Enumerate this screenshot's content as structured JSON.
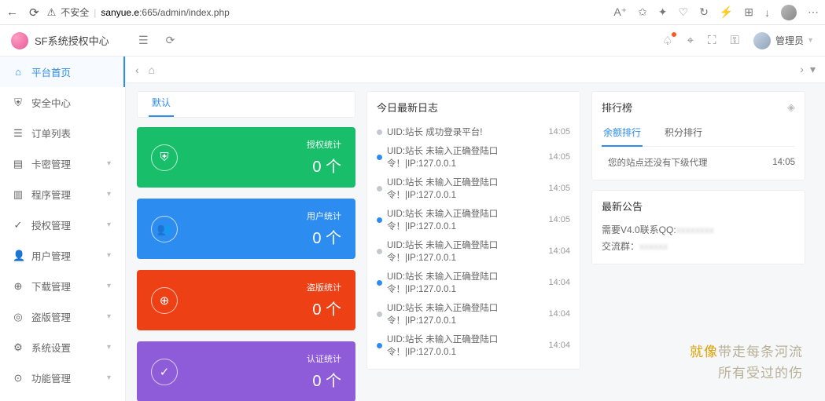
{
  "browser": {
    "insecure_label": "不安全",
    "url_host": "sanyue.e",
    "url_rest": ":665/admin/index.php"
  },
  "app": {
    "title": "SF系统授权中心"
  },
  "user": {
    "name": "管理员"
  },
  "sidebar": {
    "items": [
      {
        "label": "平台首页",
        "icon": "⌂",
        "active": true,
        "expandable": false
      },
      {
        "label": "安全中心",
        "icon": "⛨",
        "active": false,
        "expandable": false
      },
      {
        "label": "订单列表",
        "icon": "☰",
        "active": false,
        "expandable": false
      },
      {
        "label": "卡密管理",
        "icon": "▤",
        "active": false,
        "expandable": true
      },
      {
        "label": "程序管理",
        "icon": "▥",
        "active": false,
        "expandable": true
      },
      {
        "label": "授权管理",
        "icon": "✓",
        "active": false,
        "expandable": true
      },
      {
        "label": "用户管理",
        "icon": "👤",
        "active": false,
        "expandable": true
      },
      {
        "label": "下载管理",
        "icon": "⊕",
        "active": false,
        "expandable": true
      },
      {
        "label": "盗版管理",
        "icon": "◎",
        "active": false,
        "expandable": true
      },
      {
        "label": "系统设置",
        "icon": "⚙",
        "active": false,
        "expandable": true
      },
      {
        "label": "功能管理",
        "icon": "⊙",
        "active": false,
        "expandable": true
      }
    ]
  },
  "tabs": {
    "default": "默认"
  },
  "stats": [
    {
      "title": "授权统计",
      "value": "0 个",
      "cls": "c1",
      "icon": "⛨"
    },
    {
      "title": "用户统计",
      "value": "0 个",
      "cls": "c2",
      "icon": "👥"
    },
    {
      "title": "盗版统计",
      "value": "0 个",
      "cls": "c3",
      "icon": "⊕"
    },
    {
      "title": "认证统计",
      "value": "0 个",
      "cls": "c4",
      "icon": "✓"
    }
  ],
  "logs": {
    "title": "今日最新日志",
    "items": [
      {
        "dot": "grey",
        "text": "UID:站长  成功登录平台!",
        "time": "14:05"
      },
      {
        "dot": "blue",
        "text": "UID:站长 未输入正确登陆口令！|IP:127.0.0.1",
        "time": "14:05"
      },
      {
        "dot": "grey",
        "text": "UID:站长 未输入正确登陆口令！|IP:127.0.0.1",
        "time": "14:05"
      },
      {
        "dot": "blue",
        "text": "UID:站长 未输入正确登陆口令！|IP:127.0.0.1",
        "time": "14:05"
      },
      {
        "dot": "grey",
        "text": "UID:站长 未输入正确登陆口令！|IP:127.0.0.1",
        "time": "14:04"
      },
      {
        "dot": "blue",
        "text": "UID:站长 未输入正确登陆口令！|IP:127.0.0.1",
        "time": "14:04"
      },
      {
        "dot": "grey",
        "text": "UID:站长 未输入正确登陆口令！|IP:127.0.0.1",
        "time": "14:04"
      },
      {
        "dot": "blue",
        "text": "UID:站长 未输入正确登陆口令！|IP:127.0.0.1",
        "time": "14:04"
      }
    ]
  },
  "rank": {
    "title": "排行榜",
    "tabs": [
      "余额排行",
      "积分排行"
    ],
    "row": {
      "text": "您的站点还没有下级代理",
      "time": "14:05"
    }
  },
  "announce": {
    "title": "最新公告",
    "line1_a": "需要V4.0联系QQ:",
    "line1_b": "xxxxxxxx",
    "line2_a": "交流群：",
    "line2_b": "xxxxxx"
  },
  "lyric": {
    "l1a": "就像",
    "l1b": "带走每条河流",
    "l2": "所有受过的伤"
  }
}
